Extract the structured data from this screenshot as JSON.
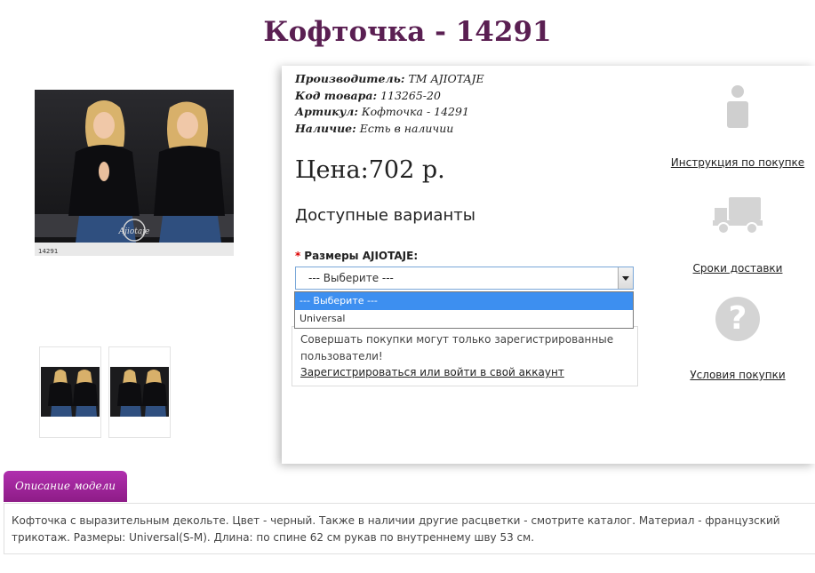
{
  "title": "Кофточка - 14291",
  "product": {
    "manufacturer_label": "Производитель:",
    "manufacturer_value": "TM AJIOTAJE",
    "code_label": "Код товара:",
    "code_value": "113265-20",
    "article_label": "Артикул:",
    "article_value": "Кофточка - 14291",
    "stock_label": "Наличие:",
    "stock_value": "Есть в наличии",
    "price": "Цена:702 р.",
    "variants_title": "Доступные варианты",
    "size_required_mark": "*",
    "size_label": "Размеры AJIOTAJE:",
    "select_value": "--- Выберите ---",
    "options": [
      "--- Выберите ---",
      "Universal"
    ]
  },
  "notice": {
    "text": "Совершать покупки могут только зарегистрированные пользователи!",
    "link": "Зарегистрироваться или войти в свой аккаунт"
  },
  "side": {
    "instructions": "Инструкция по покупке",
    "delivery": "Сроки доставки",
    "terms": "Условия покупки"
  },
  "gallery": {
    "watermark": "Ajiotaje",
    "photo_code": "14291"
  },
  "tab_label": "Описание модели",
  "description": "Кофточка с выразительным декольте. Цвет - черный. Также в наличии другие расцветки - смотрите каталог. Материал - французский трикотаж. Размеры: Universal(S-M). Длина: по спине 62 см рукав по внутреннему шву 53 см.",
  "colors": {
    "title": "#5a1f52",
    "tab": "#a0259b",
    "option_selected": "#3d8ff0",
    "icon_gray": "#cfcfcf"
  }
}
